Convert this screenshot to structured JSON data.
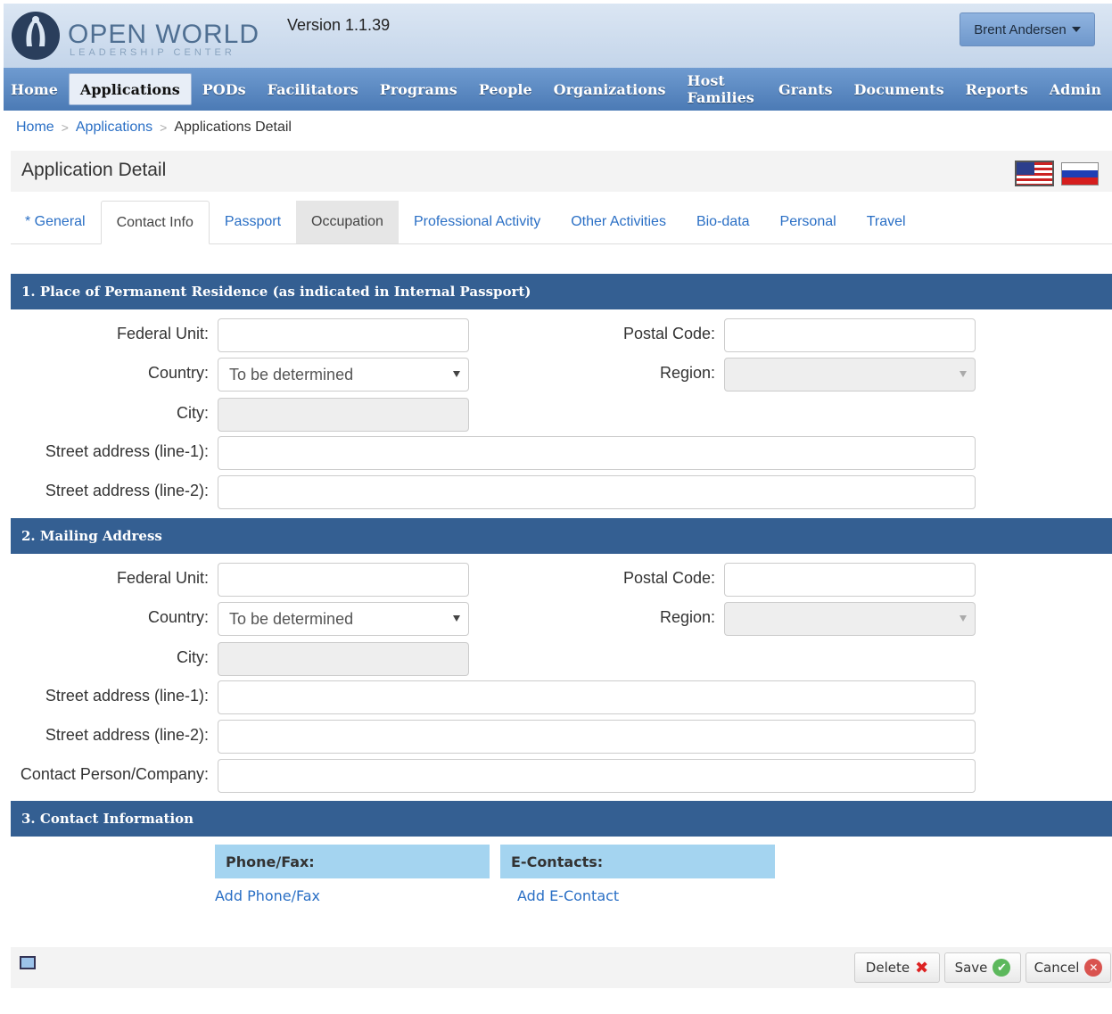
{
  "header": {
    "logo_main": "OPEN WORLD",
    "logo_sub": "LEADERSHIP CENTER",
    "version": "Version 1.1.39",
    "user": "Brent Andersen"
  },
  "nav": {
    "home": "Home",
    "applications": "Applications",
    "pods": "PODs",
    "facilitators": "Facilitators",
    "programs": "Programs",
    "people": "People",
    "organizations": "Organizations",
    "host_families": "Host Families",
    "grants": "Grants",
    "documents": "Documents",
    "reports": "Reports",
    "admin": "Admin"
  },
  "breadcrumb": {
    "home": "Home",
    "applications": "Applications",
    "current": "Applications Detail",
    "sep": ">"
  },
  "page_title": "Application Detail",
  "tabs": {
    "general": "* General",
    "contact_info": "Contact Info",
    "passport": "Passport",
    "occupation": "Occupation",
    "professional_activity": "Professional Activity",
    "other_activities": "Other Activities",
    "bio_data": "Bio-data",
    "personal": "Personal",
    "travel": "Travel"
  },
  "section1": {
    "title": "1. Place of Permanent Residence (as indicated in Internal Passport)",
    "federal_unit": "Federal Unit:",
    "postal_code": "Postal Code:",
    "country": "Country:",
    "country_value": "To be determined",
    "region": "Region:",
    "city": "City:",
    "street1": "Street address (line-1):",
    "street2": "Street address (line-2):"
  },
  "section2": {
    "title": "2. Mailing Address",
    "federal_unit": "Federal Unit:",
    "postal_code": "Postal Code:",
    "country": "Country:",
    "country_value": "To be determined",
    "region": "Region:",
    "city": "City:",
    "street1": "Street address (line-1):",
    "street2": "Street address (line-2):",
    "contact_person": "Contact Person/Company:"
  },
  "section3": {
    "title": "3. Contact Information",
    "phone_head": "Phone/Fax:",
    "econtacts_head": "E-Contacts:",
    "add_phone": "Add Phone/Fax",
    "add_econtact": "Add E-Contact"
  },
  "footer": {
    "delete": "Delete",
    "save": "Save",
    "cancel": "Cancel"
  },
  "colors": {
    "section_header": "#345f92",
    "link": "#2a6fc5",
    "nav_bg": "#4b7ab5",
    "contact_head": "#a4d4f0"
  }
}
